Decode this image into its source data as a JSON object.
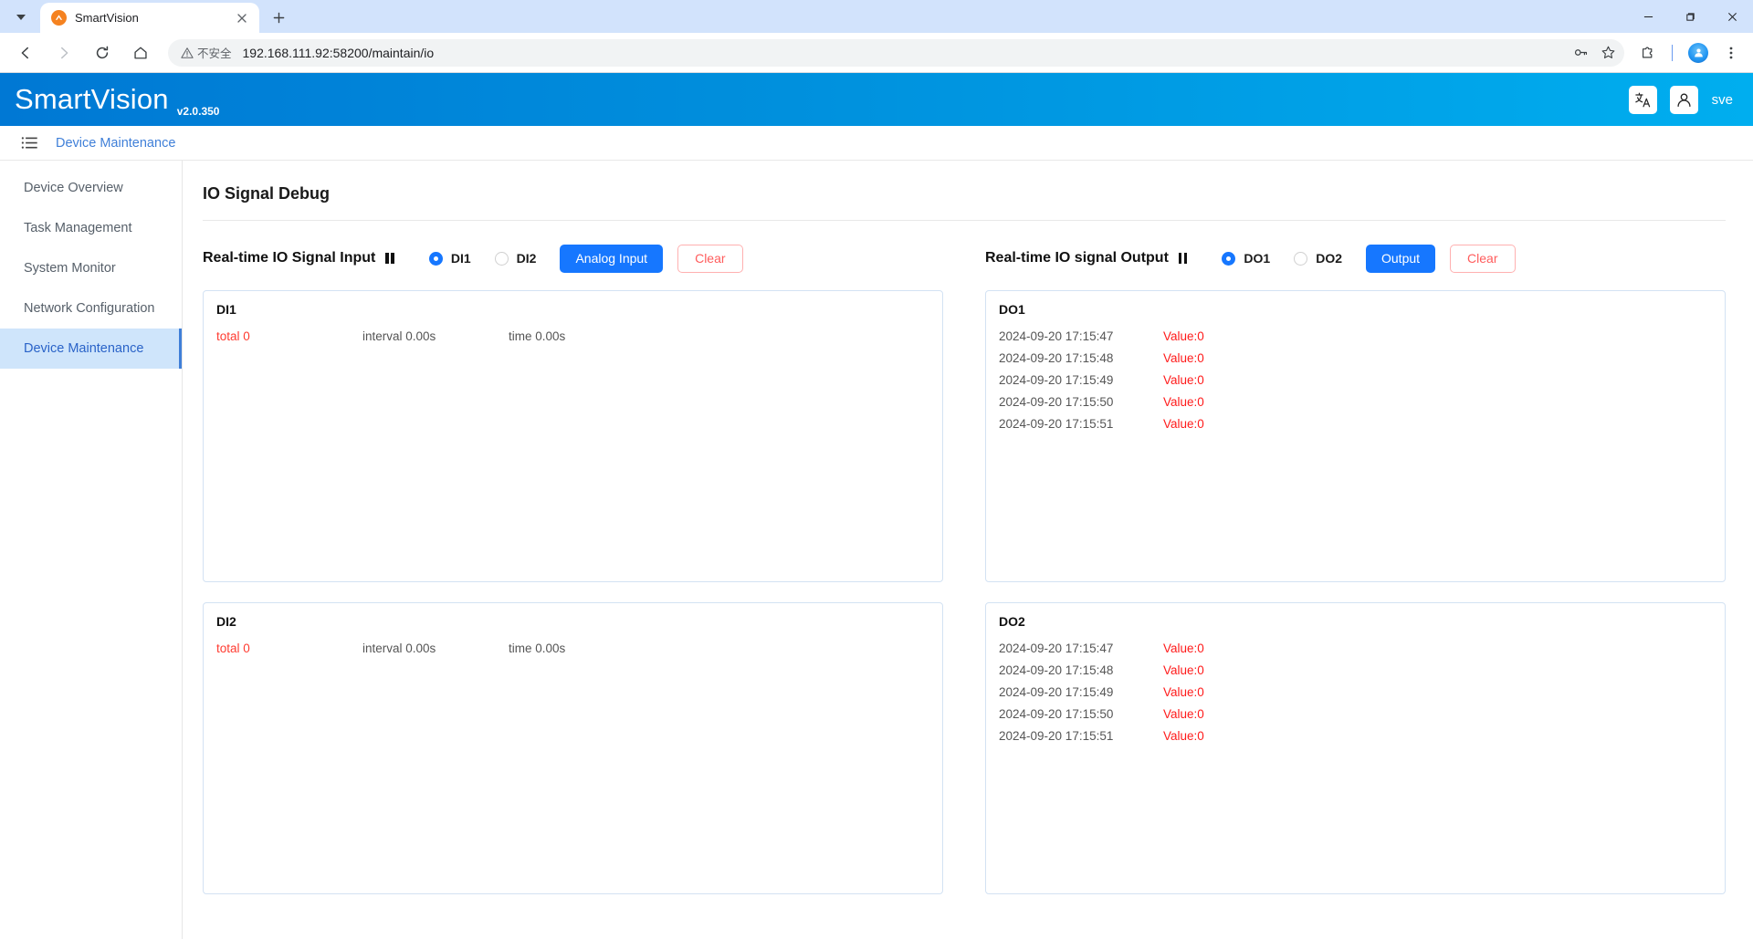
{
  "browser": {
    "tab": {
      "title": "SmartVision",
      "favicon": "smartvision-logo-icon",
      "close": "×"
    },
    "new_tab_label": "+",
    "window": {
      "minimize": "−",
      "maximize": "▢",
      "close": "✕"
    },
    "nav": {
      "back": "←",
      "forward": "→",
      "reload": "⟳",
      "home": "⌂"
    },
    "omnibox": {
      "security_label": "不安全",
      "url": "192.168.111.92:58200/maintain/io",
      "password_icon": "key-icon",
      "bookmark_icon": "star-icon"
    },
    "toolbar": {
      "extensions_icon": "puzzle-icon",
      "profile_icon": "profile-avatar-icon",
      "menu_icon": "three-dot-menu-icon"
    }
  },
  "app": {
    "brand": "SmartVision",
    "version": "v2.0.350",
    "header_buttons": {
      "translate_icon": "translate-icon",
      "user_icon": "user-icon",
      "username": "sve"
    },
    "breadcrumb": {
      "menu_icon": "list-menu-icon",
      "current": "Device Maintenance"
    },
    "sidebar": {
      "items": [
        {
          "label": "Device Overview",
          "active": false
        },
        {
          "label": "Task Management",
          "active": false
        },
        {
          "label": "System Monitor",
          "active": false
        },
        {
          "label": "Network Configuration",
          "active": false
        },
        {
          "label": "Device Maintenance",
          "active": true
        }
      ]
    },
    "page_title": "IO Signal Debug",
    "colors": {
      "header_blue_left": "#0078d4",
      "header_blue_right": "#00aeef",
      "primary": "#1677ff",
      "danger": "#ff5c5c",
      "value_red": "#ff1a1a",
      "sidebar_active_bg": "#cfe5fb"
    },
    "input_section": {
      "title": "Real-time IO Signal Input",
      "pause_icon": "pause-icon",
      "radios": [
        {
          "label": "DI1",
          "checked": true
        },
        {
          "label": "DI2",
          "checked": false
        }
      ],
      "action_button": "Analog Input",
      "clear_button": "Clear",
      "panels": [
        {
          "name": "DI1",
          "total_label": "total 0",
          "interval_label": "interval 0.00s",
          "time_label": "time 0.00s"
        },
        {
          "name": "DI2",
          "total_label": "total 0",
          "interval_label": "interval 0.00s",
          "time_label": "time 0.00s"
        }
      ]
    },
    "output_section": {
      "title": "Real-time IO signal Output",
      "pause_icon": "pause-icon",
      "radios": [
        {
          "label": "DO1",
          "checked": true
        },
        {
          "label": "DO2",
          "checked": false
        }
      ],
      "action_button": "Output",
      "clear_button": "Clear",
      "panels": [
        {
          "name": "DO1",
          "logs": [
            {
              "timestamp": "2024-09-20 17:15:47",
              "value": "Value:0"
            },
            {
              "timestamp": "2024-09-20 17:15:48",
              "value": "Value:0"
            },
            {
              "timestamp": "2024-09-20 17:15:49",
              "value": "Value:0"
            },
            {
              "timestamp": "2024-09-20 17:15:50",
              "value": "Value:0"
            },
            {
              "timestamp": "2024-09-20 17:15:51",
              "value": "Value:0"
            }
          ]
        },
        {
          "name": "DO2",
          "logs": [
            {
              "timestamp": "2024-09-20 17:15:47",
              "value": "Value:0"
            },
            {
              "timestamp": "2024-09-20 17:15:48",
              "value": "Value:0"
            },
            {
              "timestamp": "2024-09-20 17:15:49",
              "value": "Value:0"
            },
            {
              "timestamp": "2024-09-20 17:15:50",
              "value": "Value:0"
            },
            {
              "timestamp": "2024-09-20 17:15:51",
              "value": "Value:0"
            }
          ]
        }
      ]
    }
  }
}
